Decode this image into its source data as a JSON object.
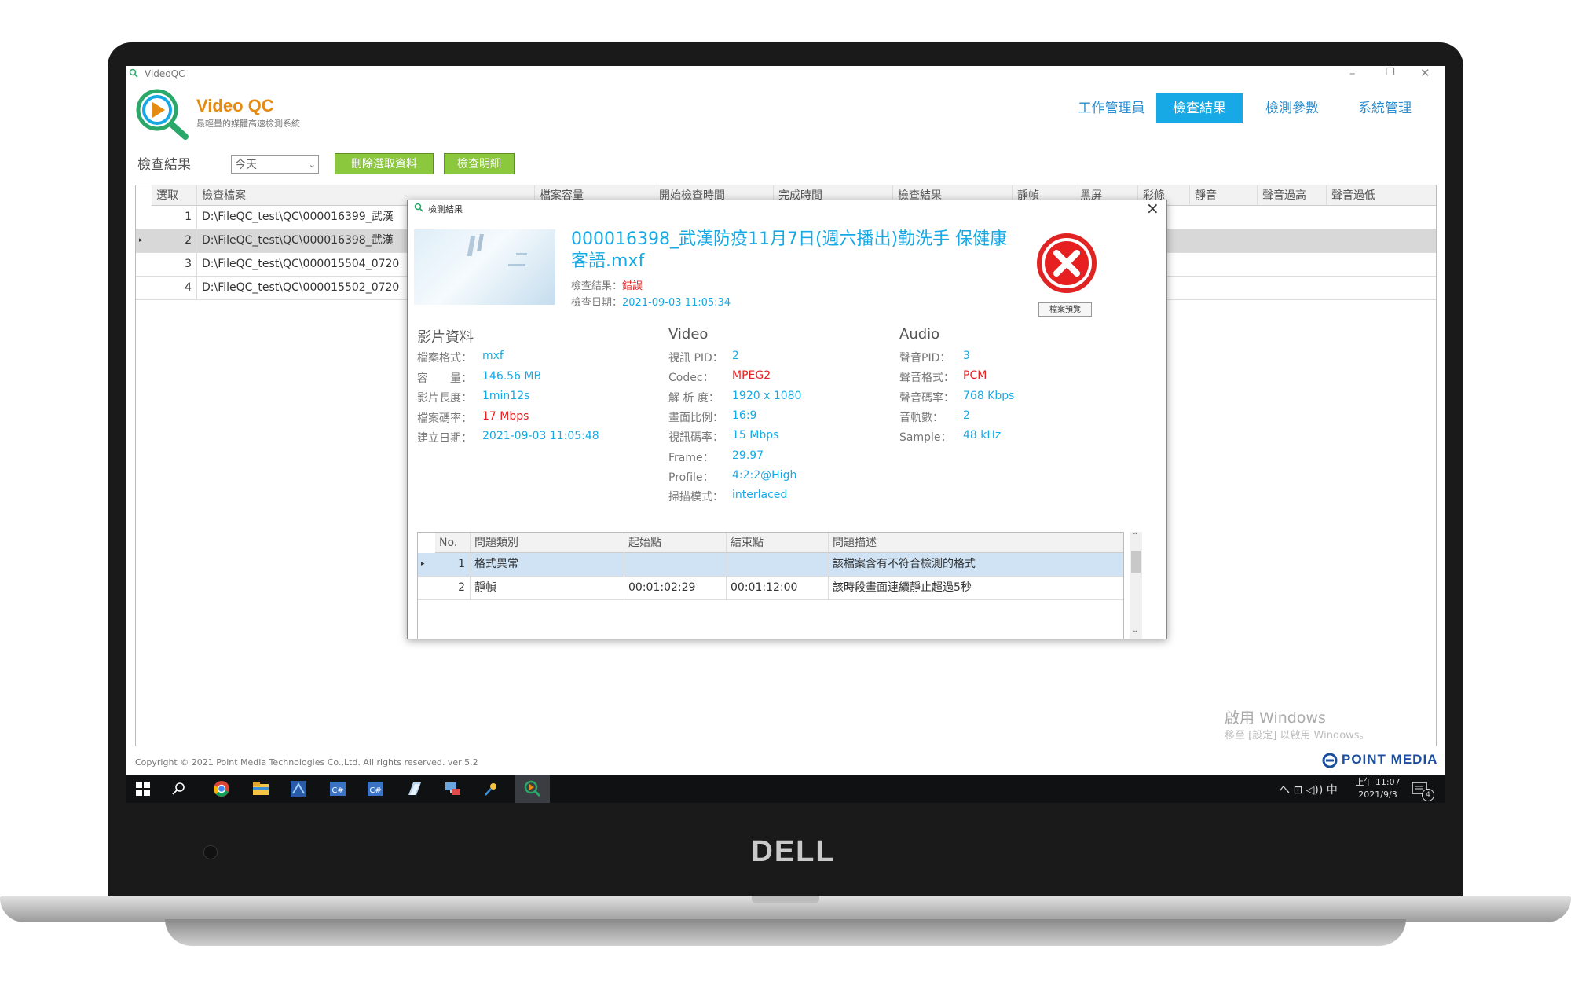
{
  "device": {
    "brand": "DELL"
  },
  "window": {
    "app_title": "VideoQC",
    "brand_name": "Video QC",
    "brand_subtitle": "最輕量的媒體高速檢測系統",
    "controls": {
      "minimize": "–",
      "restore": "❐",
      "close": "✕"
    }
  },
  "nav": {
    "items": [
      {
        "label": "工作管理員",
        "active": false
      },
      {
        "label": "檢查結果",
        "active": true
      },
      {
        "label": "檢測參數",
        "active": false
      },
      {
        "label": "系統管理",
        "active": false
      }
    ]
  },
  "toolbar": {
    "label": "檢查結果",
    "date_filter": "今天",
    "delete_button": "刪除選取資料",
    "detail_button": "檢查明細"
  },
  "results_table": {
    "columns": [
      "選取",
      "檢查檔案",
      "檔案容量",
      "開始檢查時間",
      "完成時間",
      "檢查結果",
      "靜幀",
      "黑屏",
      "彩條",
      "靜音",
      "聲音過高",
      "聲音過低"
    ],
    "rows": [
      {
        "no": "1",
        "file": "D:\\FileQC_test\\QC\\000016399_武漢",
        "selected": false
      },
      {
        "no": "2",
        "file": "D:\\FileQC_test\\QC\\000016398_武漢",
        "selected": true
      },
      {
        "no": "3",
        "file": "D:\\FileQC_test\\QC\\000015504_0720",
        "selected": false
      },
      {
        "no": "4",
        "file": "D:\\FileQC_test\\QC\\000015502_0720",
        "selected": false
      }
    ]
  },
  "dialog": {
    "title": "檢測結果",
    "close": "×",
    "file_title": "000016398_武漢防疫11月7日(週六播出)勤洗手 保健康 客語.mxf",
    "result_label": "檢查結果：",
    "result_value": "錯誤",
    "date_label": "檢查日期：",
    "date_value": "2021-09-03 11:05:34",
    "preview_button": "檔案預覽",
    "video_info": {
      "heading": "影片資料",
      "fields": [
        {
          "k": "檔案格式：",
          "v": "mxf",
          "color": "blue"
        },
        {
          "k": "容　　量：",
          "v": "146.56 MB",
          "color": "blue"
        },
        {
          "k": "影片長度：",
          "v": "1min12s",
          "color": "blue"
        },
        {
          "k": "檔案碼率：",
          "v": "17 Mbps",
          "color": "red"
        },
        {
          "k": "建立日期：",
          "v": "2021-09-03 11:05:48",
          "color": "blue"
        }
      ]
    },
    "video": {
      "heading": "Video",
      "fields": [
        {
          "k": "視訊 PID：",
          "v": "2",
          "color": "blue"
        },
        {
          "k": "Codec：",
          "v": "MPEG2",
          "color": "red"
        },
        {
          "k": "解 析 度：",
          "v": "1920 x 1080",
          "color": "blue"
        },
        {
          "k": "畫面比例：",
          "v": "16:9",
          "color": "blue"
        },
        {
          "k": "視訊碼率：",
          "v": "15 Mbps",
          "color": "blue"
        },
        {
          "k": "Frame：",
          "v": "29.97",
          "color": "blue"
        },
        {
          "k": "Profile：",
          "v": "4:2:2@High",
          "color": "blue"
        },
        {
          "k": "掃描模式：",
          "v": "interlaced",
          "color": "blue"
        }
      ]
    },
    "audio": {
      "heading": "Audio",
      "fields": [
        {
          "k": "聲音PID：",
          "v": "3",
          "color": "blue"
        },
        {
          "k": "聲音格式：",
          "v": "PCM",
          "color": "red"
        },
        {
          "k": "聲音碼率：",
          "v": "768 Kbps",
          "color": "blue"
        },
        {
          "k": "音軌數：",
          "v": "2",
          "color": "blue"
        },
        {
          "k": "Sample：",
          "v": "48 kHz",
          "color": "blue"
        }
      ]
    },
    "issues": {
      "columns": [
        "No.",
        "問題類別",
        "起始點",
        "結束點",
        "問題描述"
      ],
      "rows": [
        {
          "no": "1",
          "category": "格式異常",
          "start": "",
          "end": "",
          "desc": "該檔案含有不符合檢測的格式",
          "selected": true
        },
        {
          "no": "2",
          "category": "靜幀",
          "start": "00:01:02:29",
          "end": "00:01:12:00",
          "desc": "該時段畫面連續靜止超過5秒",
          "selected": false
        }
      ]
    }
  },
  "footer": {
    "copyright": "Copyright © 2021 Point Media Technologies Co.,Ltd. All rights reserved.   ver 5.2",
    "company_logo": "POINT MEDIA",
    "activation_title": "啟用 Windows",
    "activation_sub": "移至 [設定] 以啟用 Windows。"
  },
  "taskbar": {
    "tray": "へ  ⊡  ◁))  中",
    "time": "上午 11:07",
    "date": "2021/9/3",
    "notification_count": "4"
  },
  "colors": {
    "accent": "#17a9e6",
    "brand_orange": "#e48b12",
    "error_red": "#e62020",
    "button_green": "#8cc83e"
  }
}
